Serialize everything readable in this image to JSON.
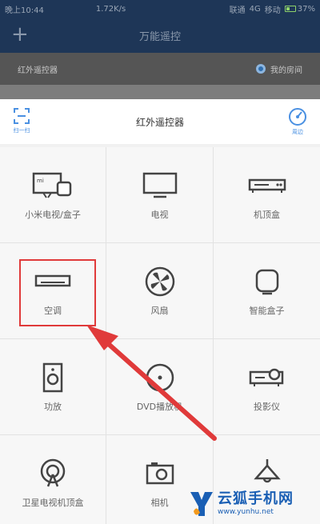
{
  "status_bar": {
    "time": "晚上10:44",
    "speed": "1.72K/s",
    "carrier_1": "联通",
    "network": "4G",
    "carrier_2": "移动",
    "battery": "37%",
    "battery_level": 0.37
  },
  "app_bar": {
    "add_label": "+",
    "title": "万能遥控"
  },
  "sub_bar": {
    "left_label": "红外遥控器",
    "room_label": "我的房间"
  },
  "sheet": {
    "title": "红外遥控器",
    "scan_label": "扫一扫",
    "nearby_label": "周边"
  },
  "devices": [
    {
      "label": "小米电视/盒子",
      "icon": "mi-tv-box-icon"
    },
    {
      "label": "电视",
      "icon": "tv-icon"
    },
    {
      "label": "机顶盒",
      "icon": "set-top-box-icon"
    },
    {
      "label": "空调",
      "icon": "air-conditioner-icon"
    },
    {
      "label": "风扇",
      "icon": "fan-icon"
    },
    {
      "label": "智能盒子",
      "icon": "smart-box-icon"
    },
    {
      "label": "功放",
      "icon": "amplifier-icon"
    },
    {
      "label": "DVD播放机",
      "icon": "dvd-player-icon"
    },
    {
      "label": "投影仪",
      "icon": "projector-icon"
    },
    {
      "label": "卫星电视机顶盒",
      "icon": "satellite-box-icon"
    },
    {
      "label": "相机",
      "icon": "camera-icon"
    },
    {
      "label": "",
      "icon": "lamp-icon"
    }
  ],
  "watermark": {
    "brand": "云狐手机网",
    "url": "www.yunhu.net"
  },
  "colors": {
    "app_bar": "#1e3657",
    "accent": "#4a90e2",
    "highlight": "#e03a3a"
  }
}
